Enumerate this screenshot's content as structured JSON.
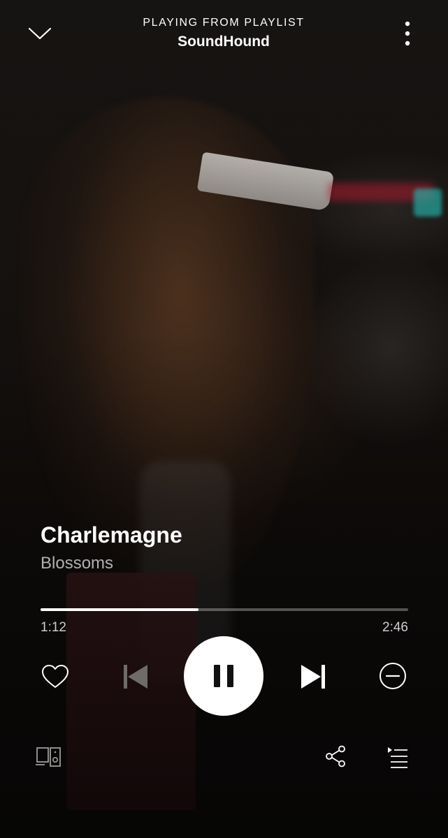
{
  "header": {
    "context_label": "PLAYING FROM PLAYLIST",
    "context_name": "SoundHound"
  },
  "track": {
    "title": "Charlemagne",
    "artist": "Blossoms"
  },
  "playback": {
    "elapsed": "1:12",
    "duration": "2:46",
    "progress_fraction": 0.43,
    "state": "playing"
  },
  "colors": {
    "primary": "#ffffff",
    "secondary_text": "#a9a9a9"
  },
  "icons": {
    "collapse": "chevron-down-icon",
    "more": "more-vertical-icon",
    "like": "heart-icon",
    "previous": "skip-previous-icon",
    "pause": "pause-icon",
    "next": "skip-next-icon",
    "hide": "minus-circle-icon",
    "devices": "devices-icon",
    "share": "share-icon",
    "queue": "queue-icon"
  }
}
